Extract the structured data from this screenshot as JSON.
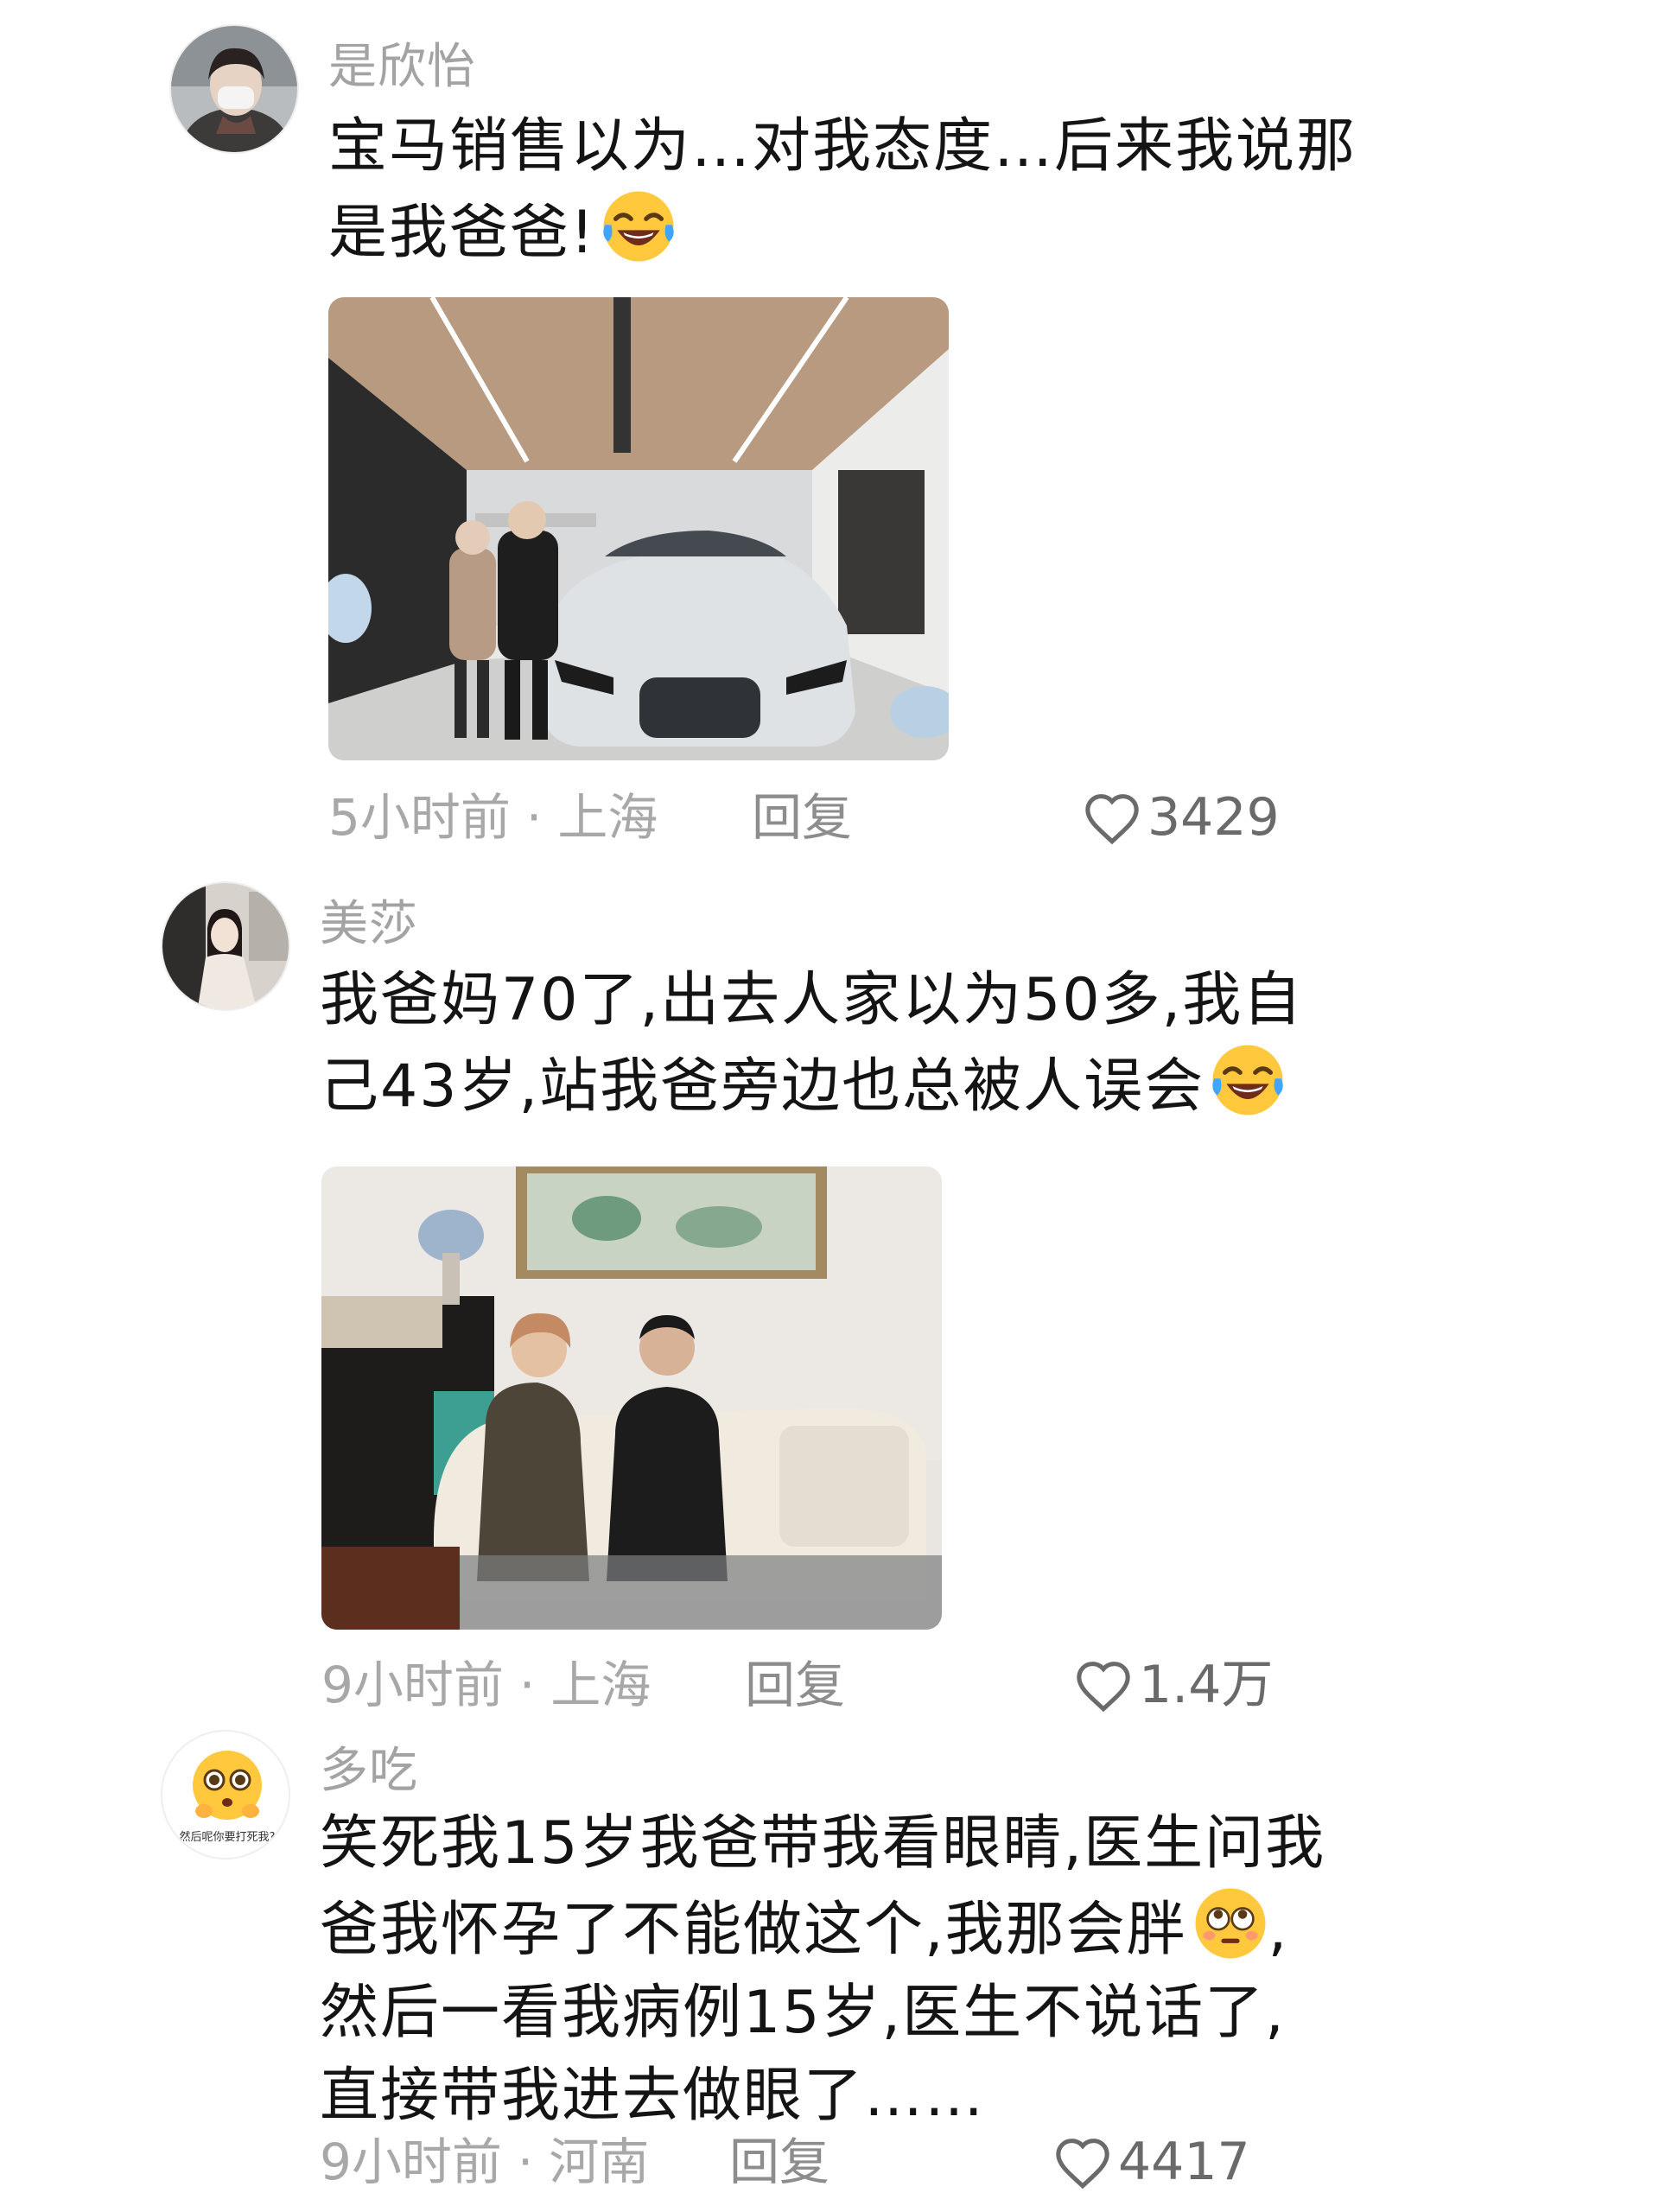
{
  "comments": [
    {
      "username": "是欣怡",
      "lines": [
        "宝马销售以为…对我态度…后来我说那",
        "是我爸爸!"
      ],
      "emoji": "rofl-emoji",
      "photo_icon": "car-showroom-photo",
      "time": "5小时前",
      "location": "上海",
      "reply_label": "回复",
      "likes": "3429"
    },
    {
      "username": "美莎",
      "lines": [
        "我爸妈70了,出去人家以为50多,我自",
        "己43岁,站我爸旁边也总被人误会"
      ],
      "emoji": "rofl-emoji",
      "photo_icon": "living-room-couple-photo",
      "time": "9小时前",
      "location": "上海",
      "reply_label": "回复",
      "likes": "1.4万"
    },
    {
      "username": "多吃",
      "avatar_caption": "然后呢你要打死我?",
      "lines": [
        "笑死我15岁我爸带我看眼睛,医生问我",
        "爸我怀孕了不能做这个,我那会胖",
        "然后一看我病例15岁,医生不说话了,",
        "直接带我进去做眼了……"
      ],
      "emoji": "flushed-emoji",
      "time": "9小时前",
      "location": "河南",
      "reply_label": "回复",
      "likes": "4417"
    }
  ],
  "separator": "·",
  "colors": {
    "meta": "#a8a8a8",
    "username": "#a3a3a3",
    "text": "#141414"
  }
}
